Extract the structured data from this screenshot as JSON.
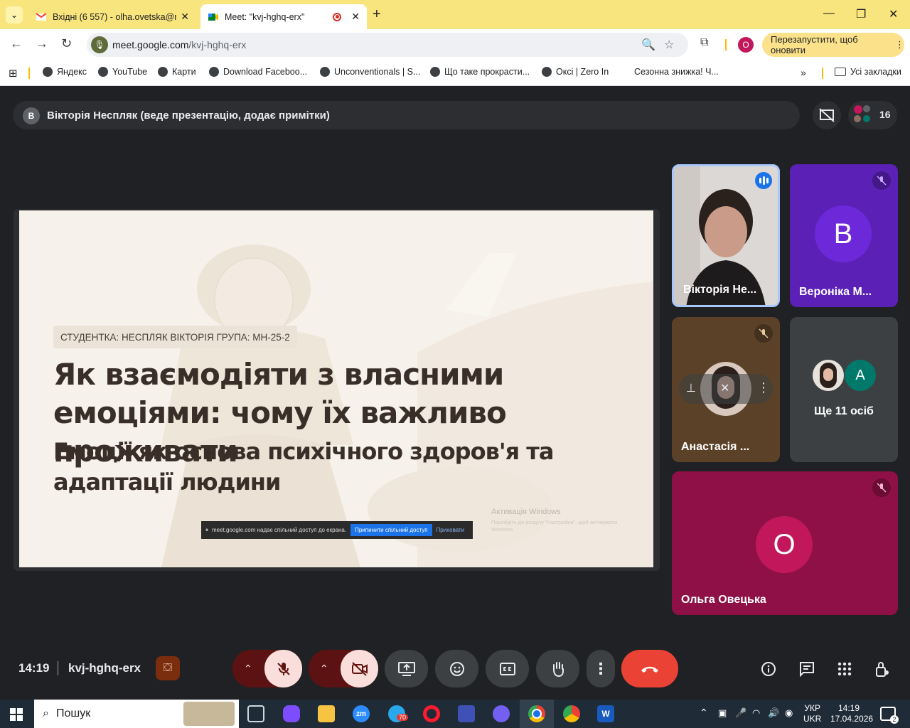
{
  "browser": {
    "tabs": [
      {
        "title": "Вхідні (6 557) - olha.ovetska@n",
        "icon": "gmail-icon"
      },
      {
        "title": "Meet: \"kvj-hghq-erx\"",
        "icon": "meet-icon"
      }
    ],
    "url_host": "meet.google.com",
    "url_path": "/kvj-hghq-erx",
    "relaunch_label": "Перезапустити, щоб оновити",
    "profile_initial": "O",
    "bookmarks": [
      "Яндекс",
      "YouTube",
      "Карти",
      "Download Faceboo...",
      "Unconventionals | S...",
      "Що таке прокрасти...",
      "Оксі | Zero In",
      "Сезонна знижка! Ч..."
    ],
    "all_bookmarks_label": "Усі закладки"
  },
  "meet": {
    "presenter_initial": "В",
    "presenter_text": "Вікторія Неспляк (веде презентацію, додає примітки)",
    "participants_count": "16",
    "slide": {
      "tag": "СТУДЕНТКА: НЕСПЛЯК ВІКТОРІЯ  ГРУПА: МН-25-2",
      "title": "Як взаємодіяти з власними емоціями: чому їх важливо проживати",
      "subtitle": "Емоції як основа психічного здоров'я та адаптації людини",
      "share_notice": "meet.google.com надає спільний доступ до екрана.",
      "share_stop": "Припинити спільний доступ",
      "share_hide": "Приховати",
      "win_activation": "Активація Windows",
      "win_activation_sub": "Перейдіть до розділу \"Настройки\", щоб активувати Windows."
    },
    "tiles": [
      {
        "name": "Вікторія Не...",
        "speaking": true
      },
      {
        "name": "Вероніка М...",
        "initial": "В",
        "color": "#5b21b6"
      },
      {
        "name": "Анастасія ..."
      },
      {
        "name": "Ще 11 осіб",
        "initial": "A"
      },
      {
        "name": "Ольга Овецька",
        "initial": "O",
        "color": "#c2185b"
      }
    ],
    "time": "14:19",
    "meeting_code": "kvj-hghq-erx"
  },
  "taskbar": {
    "search_placeholder": "Пошук",
    "telegram_badge": "70",
    "lang1": "УКР",
    "lang2": "UKR",
    "time": "14:19",
    "date": "17.04.2026",
    "notifications": "2"
  }
}
